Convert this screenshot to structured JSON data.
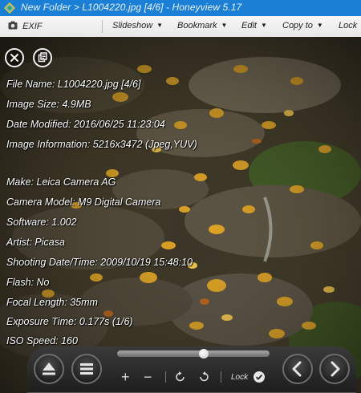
{
  "window": {
    "title": "New Folder > L1004220.jpg [4/6] - Honeyview 5.17"
  },
  "toolbar": {
    "exif_label": "EXIF",
    "slideshow_label": "Slideshow",
    "bookmark_label": "Bookmark",
    "edit_label": "Edit",
    "copyto_label": "Copy to",
    "lock_label": "Lock"
  },
  "exif": {
    "lines": [
      "File Name: L1004220.jpg [4/6]",
      "Image Size: 4.9MB",
      "Date Modified: 2016/06/25 11:23:04",
      "Image Information: 5216x3472 (Jpeg,YUV)",
      "Make: Leica Camera AG",
      "Camera Model: M9 Digital Camera",
      "Software: 1.002",
      "Artist: Picasa",
      "Shooting Date/Time: 2009/10/19 15:48:10",
      "Flash: No",
      "Focal Length: 35mm",
      "Exposure Time: 0.177s (1/6)",
      "ISO Speed: 160"
    ]
  },
  "controls": {
    "zoom_in": "+",
    "zoom_out": "−",
    "lock_label": "Lock",
    "progress": 0.57
  },
  "colors": {
    "titlebar": "#1b7fd6",
    "toolbar": "#efefef",
    "overlay_text": "#ffffff",
    "control_bar": "#262626"
  }
}
